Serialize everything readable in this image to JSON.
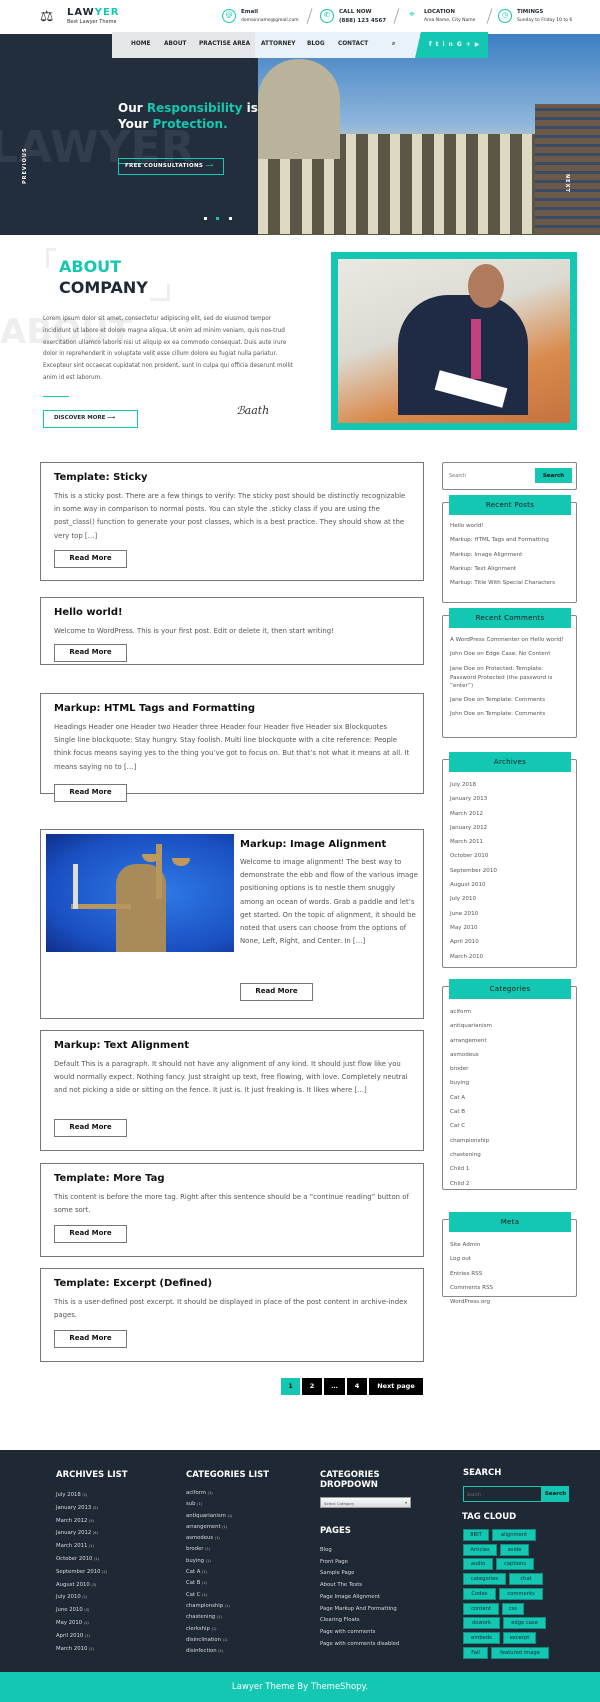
{
  "colors": {
    "accent": "#14c7b2",
    "dark": "#1f2835"
  },
  "header": {
    "logo_icon": "scales-of-justice-icon",
    "logo_title_a": "LAW",
    "logo_title_b": "YER",
    "logo_sub": "Best Lawyer Theme",
    "info": [
      {
        "icon": "email-icon",
        "title": "Email",
        "value": "domainname@gmail.com"
      },
      {
        "icon": "phone-icon",
        "title": "CALL NOW",
        "value": "(888) 123 4567"
      },
      {
        "icon": "location-pin-icon",
        "title": "LOCATION",
        "value": "Area Name, City Name"
      },
      {
        "icon": "clock-icon",
        "title": "TIMINGS",
        "value": "Sunday to Friday 10 to 6"
      }
    ]
  },
  "nav": {
    "items": [
      "HOME",
      "ABOUT",
      "PRACTISE AREA",
      "ATTORNEY",
      "BLOG",
      "CONTACT"
    ],
    "active": "HOME",
    "search_icon": "search-icon",
    "social": [
      "facebook-icon",
      "twitter-icon",
      "linkedin-icon",
      "google-plus-icon",
      "youtube-icon"
    ]
  },
  "hero": {
    "watermark": "LAWYER",
    "line1_a": "Our ",
    "line1_b": "Responsibility",
    "line1_c": " is",
    "line2_a": "Your ",
    "line2_b": "Protection.",
    "button": "FREE COUNSULTATIONS",
    "prev": "PREVIOUS",
    "next": "NEXT",
    "active_slide": 2,
    "slides": 3
  },
  "about": {
    "watermark": "ABOUT",
    "title_a": "ABOUT",
    "title_b": "COMPANY",
    "text": "Lorem ipsum dolor sit amet, consectetur adipiscing elit, sed do eiusmod tempor incididunt ut labore et dolore magna aliqua. Ut enim ad minim veniam, quis nos-trud exercitation ullamco laboris nisi ut aliquip ex ea commodo consequat. Duis aute irure dolor in reprehenderit in voluptate velit esse cillum dolore eu fugiat nulla pariatur. Excepteur sint occaecat cupidatat non proident, sunt in culpa qui officia deserunt mollit anim id est laborum.",
    "button": "DISCOVER MORE",
    "signature": "Baath"
  },
  "posts": [
    {
      "title": "Template: Sticky",
      "excerpt": "This is a sticky post. There are a few things to verify: The sticky post should be distinctly recognizable in some way in comparison to normal posts. You can style the .sticky class if you are using the post_class() function to generate your post classes, which is a best practice. They should show at the very top […]",
      "button": "Read More"
    },
    {
      "title": "Hello world!",
      "excerpt": "Welcome to WordPress. This is your first post. Edit or delete it, then start writing!",
      "button": "Read More"
    },
    {
      "title": "Markup: HTML Tags and Formatting",
      "excerpt": "Headings Header one Header two Header three Header four Header five Header six Blockquotes Single line blockquote: Stay hungry. Stay foolish. Multi line blockquote with a cite reference: People think focus means saying yes to the thing you’ve got to focus on. But that’s not what it means at all. It means saying no to […]",
      "button": "Read More"
    },
    {
      "title": "Markup: Image Alignment",
      "excerpt": "Welcome to image alignment! The best way to demonstrate the ebb and flow of the various image positioning options is to nestle them snuggly among an ocean of words. Grab a paddle and let’s get started. On the topic of alignment, it should be noted that users can choose from the options of None, Left, Right, and Center. In […]",
      "button": "Read More"
    },
    {
      "title": "Markup: Text Alignment",
      "excerpt": "Default This is a paragraph. It should not have any alignment of any kind. It should just flow like you would normally expect. Nothing fancy. Just straight up text, free flowing, with love. Completely neutral and not picking a side or sitting on the fence. It just is. It just freaking is. It likes where […]",
      "button": "Read More"
    },
    {
      "title": "Template: More Tag",
      "excerpt": "This content is before the more tag. Right after this sentence should be a “continue reading” button of some sort.",
      "button": "Read More"
    },
    {
      "title": "Template: Excerpt (Defined)",
      "excerpt": "This is a user-defined post excerpt. It should be displayed in place of the post content in archive-index pages.",
      "button": "Read More"
    }
  ],
  "pagination": {
    "pages": [
      "1",
      "2",
      "…",
      "4"
    ],
    "current": "1",
    "next": "Next page"
  },
  "sidebar": {
    "search_placeholder": "Search",
    "search_button": "Search",
    "recent_posts": {
      "title": "Recent Posts",
      "items": [
        "Hello world!",
        "Markup: HTML Tags and Formatting",
        "Markup: Image Alignment",
        "Markup: Text Alignment",
        "Markup: Title With Special Characters"
      ]
    },
    "recent_comments": {
      "title": "Recent Comments",
      "items": [
        "A WordPress Commenter on Hello world!",
        "John Doe on Edge Case: No Content",
        "Jane Doe on Protected: Template: Password Protected (the password is “enter”)",
        "Jane Doe on Template: Comments",
        "John Doe on Template: Comments"
      ]
    },
    "archives": {
      "title": "Archives",
      "items": [
        "July 2018",
        "January 2013",
        "March 2012",
        "January 2012",
        "March 2011",
        "October 2010",
        "September 2010",
        "August 2010",
        "July 2010",
        "June 2010",
        "May 2010",
        "April 2010",
        "March 2010"
      ]
    },
    "categories": {
      "title": "Categories",
      "items": [
        "aciform",
        "antiquarianism",
        "arrangement",
        "asmodeus",
        "broder",
        "buying",
        "Cat A",
        "Cat B",
        "Cat C",
        "championship",
        "chastening",
        "Child 1",
        "Child 2"
      ]
    },
    "meta": {
      "title": "Meta",
      "items": [
        "Site Admin",
        "Log out",
        "Entries RSS",
        "Comments RSS",
        "WordPress.org"
      ]
    }
  },
  "footer": {
    "archives": {
      "title": "ARCHIVES LIST",
      "items": [
        [
          "July 2018",
          "(1)"
        ],
        [
          "January 2013",
          "(5)"
        ],
        [
          "March 2012",
          "(5)"
        ],
        [
          "January 2012",
          "(6)"
        ],
        [
          "March 2011",
          "(1)"
        ],
        [
          "October 2010",
          "(1)"
        ],
        [
          "September 2010",
          "(2)"
        ],
        [
          "August 2010",
          "(3)"
        ],
        [
          "July 2010",
          "(1)"
        ],
        [
          "June 2010",
          "(3)"
        ],
        [
          "May 2010",
          "(1)"
        ],
        [
          "April 2010",
          "(1)"
        ],
        [
          "March 2010",
          "(1)"
        ]
      ]
    },
    "categories": {
      "title": "CATEGORIES LIST",
      "items": [
        [
          "aciform",
          "(1)"
        ],
        [
          "sub",
          "(1)"
        ],
        [
          "antiquarianism",
          "(1)"
        ],
        [
          "arrangement",
          "(1)"
        ],
        [
          "asmodeus",
          "(1)"
        ],
        [
          "broder",
          "(1)"
        ],
        [
          "buying",
          "(1)"
        ],
        [
          "Cat A",
          "(1)"
        ],
        [
          "Cat B",
          "(1)"
        ],
        [
          "Cat C",
          "(1)"
        ],
        [
          "championship",
          "(1)"
        ],
        [
          "chastening",
          "(1)"
        ],
        [
          "clerkship",
          "(1)"
        ],
        [
          "disinclination",
          "(1)"
        ],
        [
          "disinfection",
          "(1)"
        ]
      ]
    },
    "dropdown": {
      "title": "CATEGORIES DROPDOWN",
      "selected": "Select Category"
    },
    "pages": {
      "title": "PAGES",
      "items": [
        "Blog",
        "Front Page",
        "Sample Page",
        "About The Tests",
        "Page Image Alignment",
        "Page Markup And Formatting",
        "Clearing Floats",
        "Page with comments",
        "Page with comments disabled"
      ]
    },
    "search": {
      "title": "SEARCH",
      "placeholder": "Search",
      "button": "Search"
    },
    "tags": {
      "title": "TAG CLOUD",
      "items": [
        "8BIT",
        "alignment",
        "Articles",
        "aside",
        "audio",
        "captions",
        "categories",
        "chat",
        "Codex",
        "comments",
        "content",
        "css",
        "dowork",
        "edge case",
        "embeds",
        "excerpt",
        "Fail",
        "featured image"
      ]
    },
    "copyright": "Lawyer Theme By ThemeShopy."
  }
}
